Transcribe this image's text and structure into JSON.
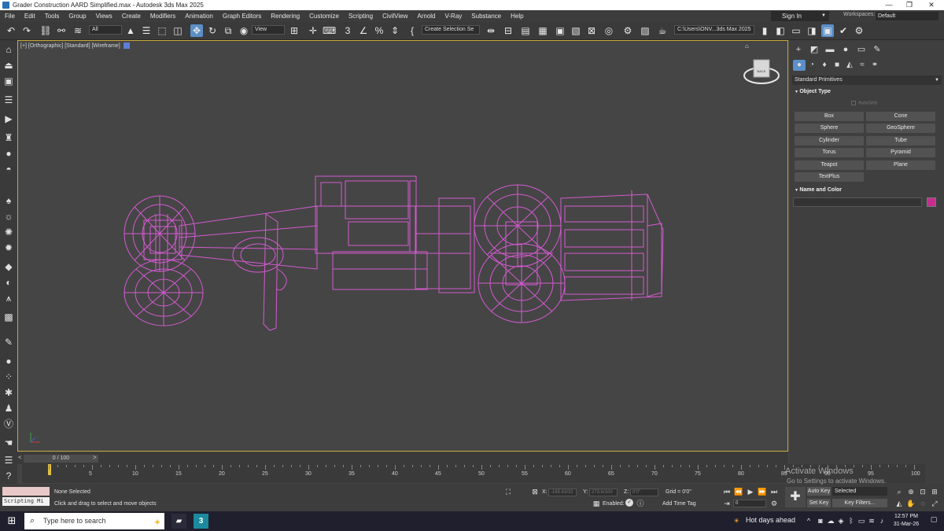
{
  "window": {
    "title": "Grader Construction AARD Simplified.max - Autodesk 3ds Max 2025",
    "controls": {
      "minimize": "—",
      "maximize": "❐",
      "close": "✕"
    }
  },
  "menu": {
    "items": [
      "File",
      "Edit",
      "Tools",
      "Group",
      "Views",
      "Create",
      "Modifiers",
      "Animation",
      "Graph Editors",
      "Rendering",
      "Customize",
      "Scripting",
      "CivilView",
      "Arnold",
      "V-Ray",
      "Substance",
      "Help"
    ],
    "sign_in": "Sign In",
    "workspaces_label": "Workspaces:",
    "workspace_value": "Default"
  },
  "toolbar": {
    "selection_filter": "All",
    "reference_coord": "View",
    "selection_set": "Create Selection Se",
    "project_path": "C:\\Users\\ONV...3ds Max 2025"
  },
  "viewport": {
    "label": "[+] [Orthographic] [Standard] [Wireframe]",
    "viewcube_label": "BACK",
    "wire_color": "#d35ad0"
  },
  "command_panel": {
    "category": "Standard Primitives",
    "object_type_title": "Object Type",
    "autogrid": "AutoGrid",
    "buttons": [
      "Box",
      "Cone",
      "Sphere",
      "GeoSphere",
      "Cylinder",
      "Tube",
      "Torus",
      "Pyramid",
      "Teapot",
      "Plane",
      "TextPlus"
    ],
    "name_color_title": "Name and Color",
    "object_color": "#c42e8e"
  },
  "timeline": {
    "slider": "0 / 100",
    "ticks": [
      "0",
      "5",
      "10",
      "15",
      "20",
      "25",
      "30",
      "35",
      "40",
      "45",
      "50",
      "55",
      "60",
      "65",
      "70",
      "75",
      "80",
      "85",
      "90",
      "95",
      "100"
    ]
  },
  "status": {
    "maxscript": "Scripting Mi",
    "selection": "None Selected",
    "prompt": "Click and drag to select and move objects",
    "x_label": "X:",
    "x_value": "-165.63/32",
    "y_label": "Y:",
    "y_value": "273.6/100",
    "z_label": "Z:",
    "z_value": "0'0\"",
    "grid": "Grid = 0'0\"",
    "enabled": "Enabled:",
    "add_time_tag": "Add Time Tag",
    "frame": "0",
    "auto_key": "Auto Key",
    "selected": "Selected",
    "set_key": "Set Key",
    "key_filters": "Key Filters..."
  },
  "watermark": {
    "line1": "Activate Windows",
    "line2": "Go to Settings to activate Windows."
  },
  "taskbar": {
    "search_placeholder": "Type here to search",
    "weather": "Hot days ahead",
    "time": "12:57 PM",
    "date": "31-Mar-26",
    "max_icon": "3"
  }
}
